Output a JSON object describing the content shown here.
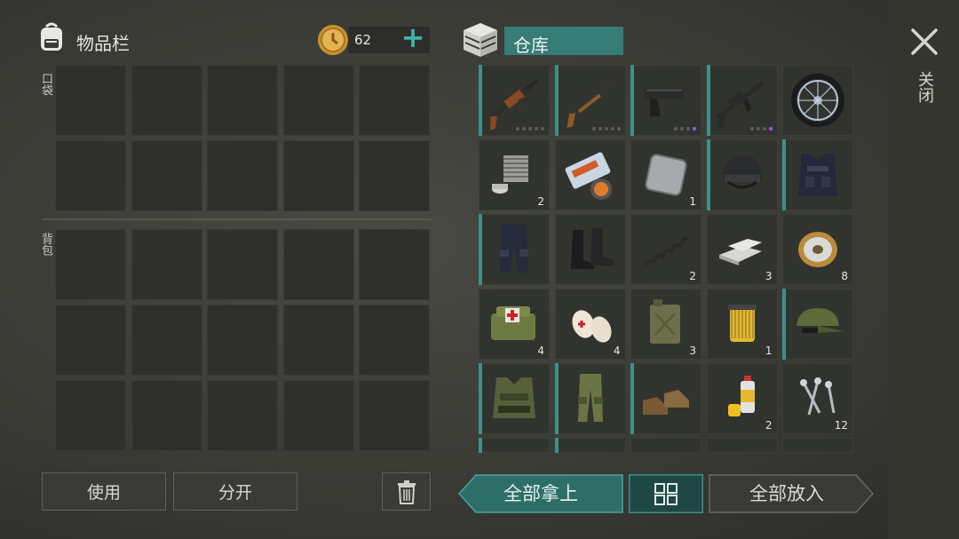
{
  "inventory": {
    "title": "物品栏",
    "pocket_label": "口袋",
    "backpack_label": "背包"
  },
  "currency": {
    "amount": "62",
    "add_symbol": "+"
  },
  "storage": {
    "title": "仓库"
  },
  "close": {
    "label": "关闭"
  },
  "storage_items": [
    {
      "name": "ak-rifle",
      "count": "",
      "dots": 5,
      "purple": false
    },
    {
      "name": "pump-shotgun",
      "count": "",
      "dots": 5,
      "purple": false
    },
    {
      "name": "pistol",
      "count": "",
      "dots": 4,
      "purple": true
    },
    {
      "name": "m16-rifle",
      "count": "",
      "dots": 4,
      "purple": true
    },
    {
      "name": "wheel",
      "count": ""
    },
    {
      "name": "engine-cylinder",
      "count": "2"
    },
    {
      "name": "duct-tape-rolls",
      "count": ""
    },
    {
      "name": "steel-plate",
      "count": "1"
    },
    {
      "name": "tactical-helmet",
      "count": ""
    },
    {
      "name": "police-vest",
      "count": ""
    },
    {
      "name": "police-pants",
      "count": ""
    },
    {
      "name": "black-boots",
      "count": ""
    },
    {
      "name": "spring",
      "count": "2"
    },
    {
      "name": "metal-bars",
      "count": "3"
    },
    {
      "name": "wire-spool",
      "count": "8"
    },
    {
      "name": "medical-bag",
      "count": "4"
    },
    {
      "name": "bandages",
      "count": "4"
    },
    {
      "name": "jerrycan",
      "count": "3"
    },
    {
      "name": "oil-filter",
      "count": "1"
    },
    {
      "name": "military-cap",
      "count": ""
    },
    {
      "name": "camo-vest",
      "count": ""
    },
    {
      "name": "camo-pants",
      "count": ""
    },
    {
      "name": "brown-boots",
      "count": ""
    },
    {
      "name": "spray-paint",
      "count": "2"
    },
    {
      "name": "nails",
      "count": "12"
    }
  ],
  "buttons": {
    "use": "使用",
    "split": "分开",
    "take_all": "全部拿上",
    "put_all": "全部放入"
  },
  "colors": {
    "accent": "#3f8f8a",
    "teal_button": "#2e6e69"
  }
}
